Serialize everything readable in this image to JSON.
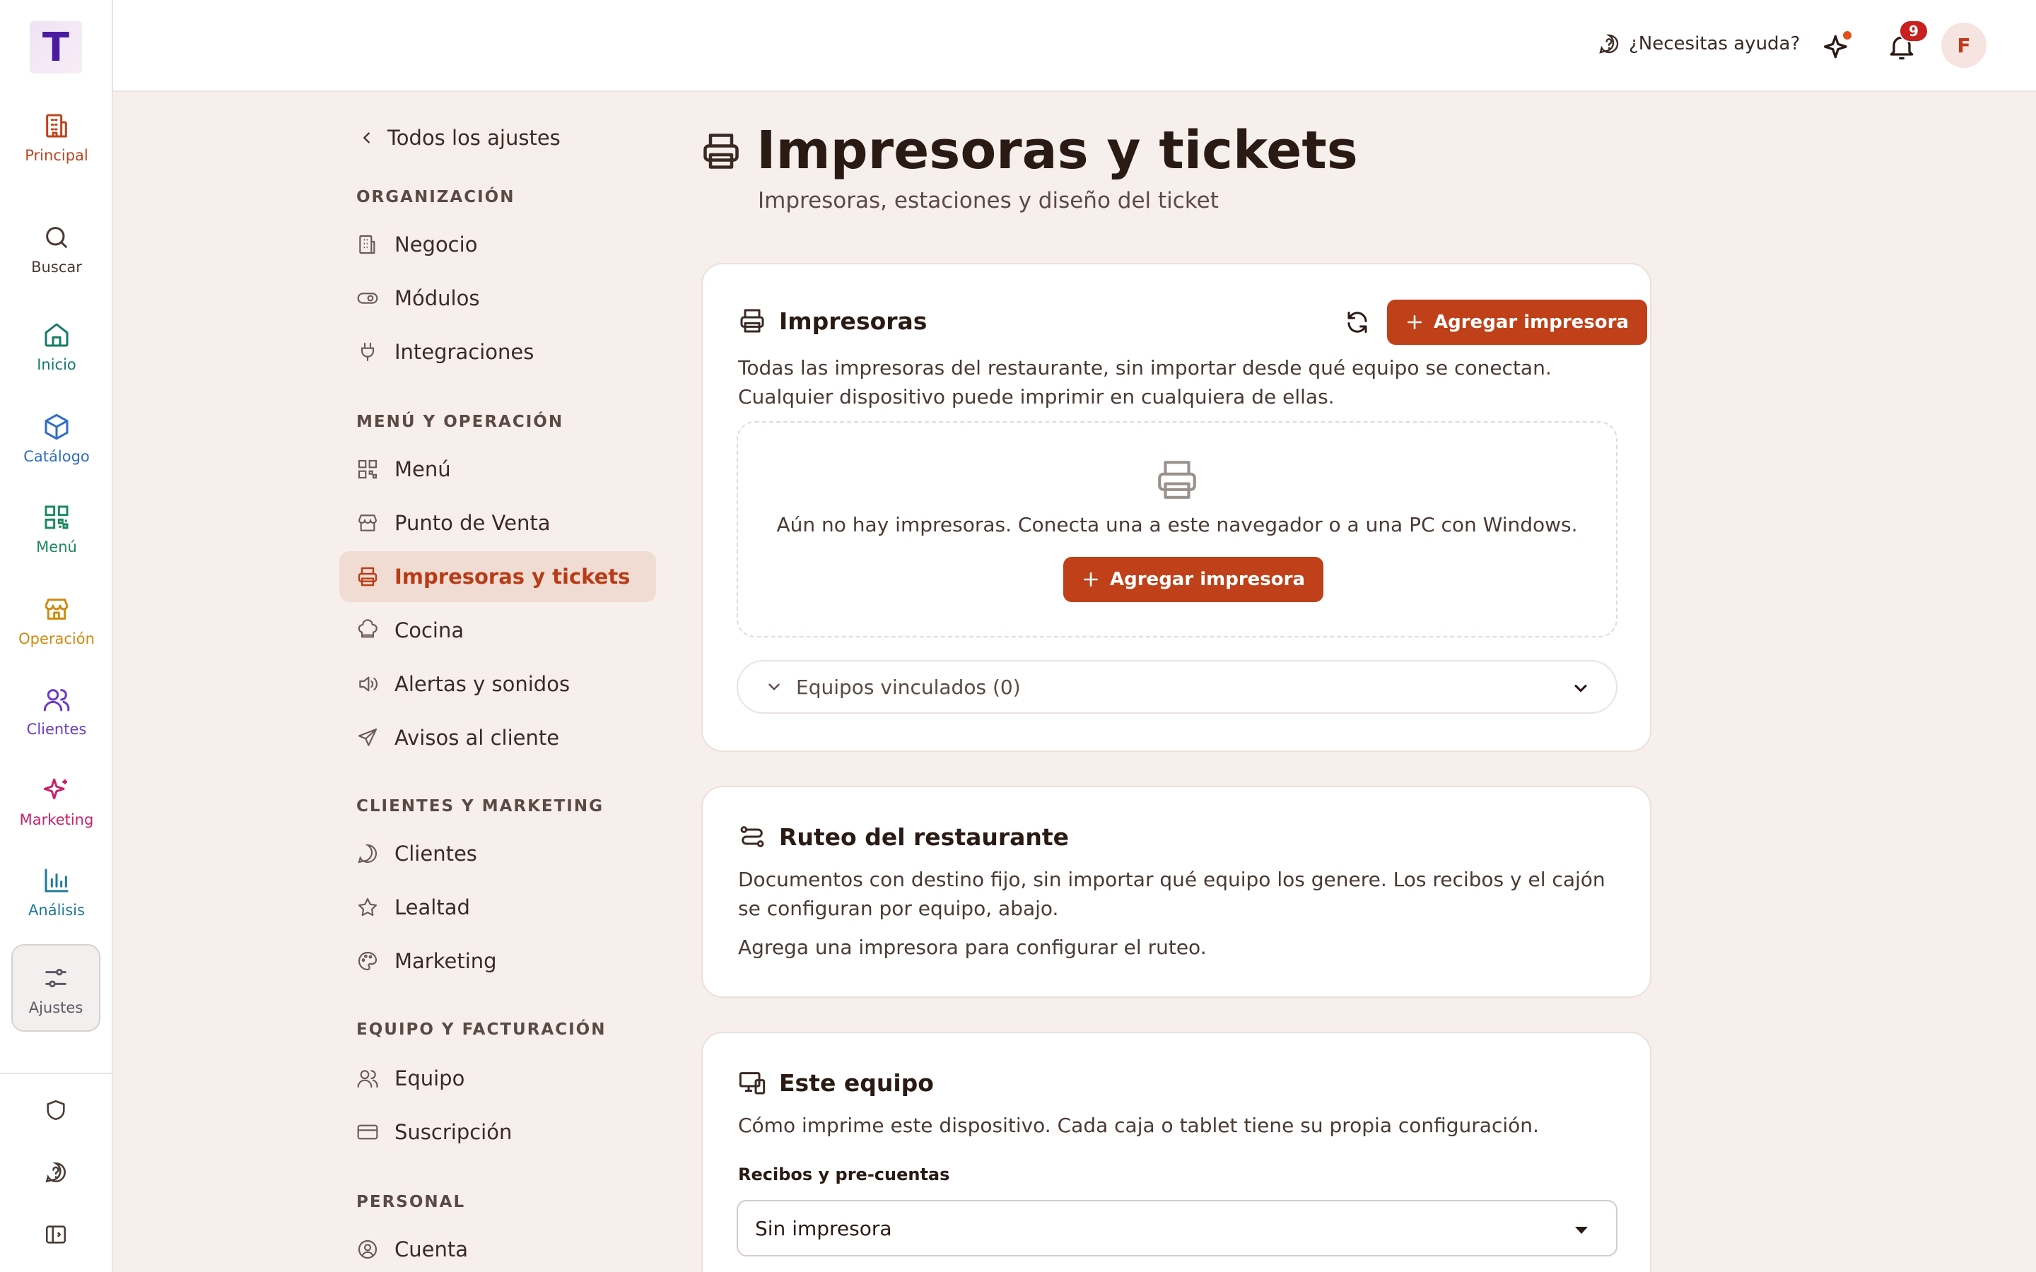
{
  "app": {
    "logo_letter": "T"
  },
  "rail": {
    "items": [
      {
        "label": "Principal",
        "color": "#c0431c"
      },
      {
        "label": "Buscar",
        "color": "#4a3a34"
      },
      {
        "label": "Inicio",
        "color": "#167a6a"
      },
      {
        "label": "Catálogo",
        "color": "#2f6cc8"
      },
      {
        "label": "Menú",
        "color": "#1c8a5c"
      },
      {
        "label": "Operación",
        "color": "#d08a10"
      },
      {
        "label": "Clientes",
        "color": "#6a3ac8"
      },
      {
        "label": "Marketing",
        "color": "#c8206a"
      },
      {
        "label": "Análisis",
        "color": "#1f7a9a"
      },
      {
        "label": "Ajustes",
        "color": "#5a5a66"
      }
    ]
  },
  "topbar": {
    "help_label": "¿Necesitas ayuda?",
    "notifications_count": "9",
    "avatar_initial": "F"
  },
  "settings_nav": {
    "back_label": "Todos los ajustes",
    "sections": [
      {
        "title": "ORGANIZACIÓN",
        "items": [
          "Negocio",
          "Módulos",
          "Integraciones"
        ]
      },
      {
        "title": "MENÚ Y OPERACIÓN",
        "items": [
          "Menú",
          "Punto de Venta",
          "Impresoras y tickets",
          "Cocina",
          "Alertas y sonidos",
          "Avisos al cliente"
        ]
      },
      {
        "title": "CLIENTES Y MARKETING",
        "items": [
          "Clientes",
          "Lealtad",
          "Marketing"
        ]
      },
      {
        "title": "EQUIPO Y FACTURACIÓN",
        "items": [
          "Equipo",
          "Suscripción"
        ]
      },
      {
        "title": "PERSONAL",
        "items": [
          "Cuenta"
        ]
      }
    ],
    "active_item": "Impresoras y tickets"
  },
  "page": {
    "title": "Impresoras y tickets",
    "subtitle": "Impresoras, estaciones y diseño del ticket"
  },
  "printers_card": {
    "title": "Impresoras",
    "add_button": "Agregar impresora",
    "description": "Todas las impresoras del restaurante, sin importar desde qué equipo se conectan. Cualquier dispositivo puede imprimir en cualquiera de ellas.",
    "empty_text": "Aún no hay impresoras. Conecta una a este navegador o a una PC con Windows.",
    "empty_add_button": "Agregar impresora",
    "linked_label": "Equipos vinculados (0)"
  },
  "routing_card": {
    "title": "Ruteo del restaurante",
    "description": "Documentos con destino fijo, sin importar qué equipo los genere. Los recibos y el cajón se configuran por equipo, abajo.",
    "hint": "Agrega una impresora para configurar el ruteo."
  },
  "device_card": {
    "title": "Este equipo",
    "description": "Cómo imprime este dispositivo. Cada caja o tablet tiene su propia configuración.",
    "receipts_label": "Recibos y pre-cuentas",
    "receipts_value": "Sin impresora"
  },
  "colors": {
    "accent": "#bf4019",
    "active_bg": "#f1dcd3",
    "page_bg": "#f7efec"
  }
}
